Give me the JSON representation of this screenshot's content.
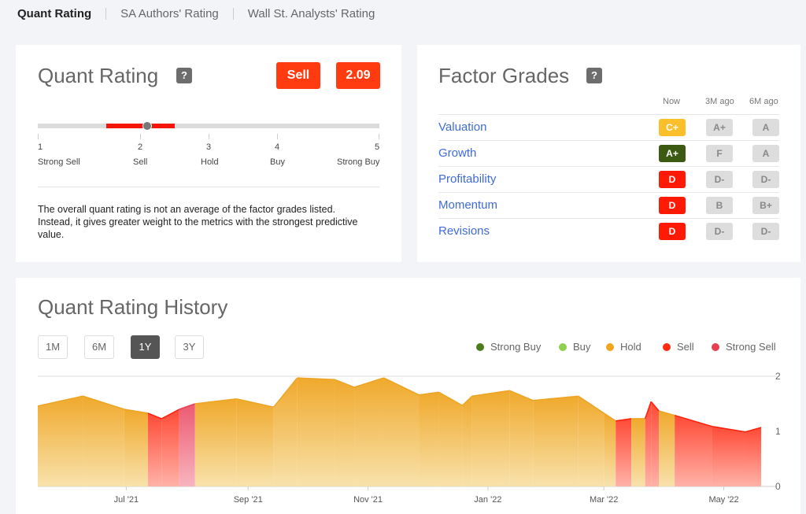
{
  "tabs": [
    "Quant Rating",
    "SA Authors' Rating",
    "Wall St. Analysts' Rating"
  ],
  "quant": {
    "title": "Quant Rating",
    "help": "?",
    "rating": "Sell",
    "score": "2.09",
    "scale": [
      {
        "n": "1",
        "label": "Strong Sell"
      },
      {
        "n": "2",
        "label": "Sell"
      },
      {
        "n": "3",
        "label": "Hold"
      },
      {
        "n": "4",
        "label": "Buy"
      },
      {
        "n": "5",
        "label": "Strong Buy"
      }
    ],
    "description": "The overall quant rating is not an average of the factor grades listed. Instead, it gives greater weight to the metrics with the strongest predictive value."
  },
  "factors": {
    "title": "Factor Grades",
    "help": "?",
    "columns": [
      "Now",
      "3M ago",
      "6M ago"
    ],
    "rows": [
      {
        "name": "Valuation",
        "now": "C+",
        "m3": "A+",
        "m6": "A",
        "now_color": "#fbbf2c"
      },
      {
        "name": "Growth",
        "now": "A+",
        "m3": "F",
        "m6": "A",
        "now_color": "#3d5a12"
      },
      {
        "name": "Profitability",
        "now": "D",
        "m3": "D-",
        "m6": "D-",
        "now_color": "#ff1a05"
      },
      {
        "name": "Momentum",
        "now": "D",
        "m3": "B",
        "m6": "B+",
        "now_color": "#ff1a05"
      },
      {
        "name": "Revisions",
        "now": "D",
        "m3": "D-",
        "m6": "D-",
        "now_color": "#ff1a05"
      }
    ]
  },
  "history": {
    "title": "Quant Rating History",
    "periods": [
      "1M",
      "6M",
      "1Y",
      "3Y"
    ],
    "active_period": "1Y",
    "legend": [
      {
        "label": "Strong Buy",
        "color": "#4a7c1c"
      },
      {
        "label": "Buy",
        "color": "#8fd14f"
      },
      {
        "label": "Hold",
        "color": "#f0a51e"
      },
      {
        "label": "Sell",
        "color": "#ff2a12"
      },
      {
        "label": "Strong Sell",
        "color": "#e8404f"
      }
    ]
  },
  "chart_data": {
    "type": "area",
    "x_start": "2021-05-17",
    "x_end": "2022-05-20",
    "ylim": [
      0,
      2
    ],
    "yticks": [
      "0",
      "1",
      "2"
    ],
    "xticks": [
      {
        "label": "Jul '21",
        "date": "2021-07-01"
      },
      {
        "label": "Sep '21",
        "date": "2021-09-01"
      },
      {
        "label": "Nov '21",
        "date": "2021-11-01"
      },
      {
        "label": "Jan '22",
        "date": "2022-01-01"
      },
      {
        "label": "Mar '22",
        "date": "2022-03-01"
      },
      {
        "label": "May '22",
        "date": "2022-05-01"
      }
    ],
    "points": [
      {
        "date": "2021-05-17",
        "value": 1.46,
        "rating": "Hold"
      },
      {
        "date": "2021-06-09",
        "value": 1.64,
        "rating": "Hold"
      },
      {
        "date": "2021-06-30",
        "value": 1.4,
        "rating": "Hold"
      },
      {
        "date": "2021-07-12",
        "value": 1.33,
        "rating": "Sell"
      },
      {
        "date": "2021-07-19",
        "value": 1.23,
        "rating": "Sell"
      },
      {
        "date": "2021-07-28",
        "value": 1.4,
        "rating": "Strong Sell"
      },
      {
        "date": "2021-08-05",
        "value": 1.5,
        "rating": "Hold"
      },
      {
        "date": "2021-08-26",
        "value": 1.59,
        "rating": "Hold"
      },
      {
        "date": "2021-09-14",
        "value": 1.44,
        "rating": "Hold"
      },
      {
        "date": "2021-09-26",
        "value": 1.97,
        "rating": "Hold"
      },
      {
        "date": "2021-10-15",
        "value": 1.94,
        "rating": "Hold"
      },
      {
        "date": "2021-10-25",
        "value": 1.8,
        "rating": "Hold"
      },
      {
        "date": "2021-11-09",
        "value": 1.97,
        "rating": "Hold"
      },
      {
        "date": "2021-11-27",
        "value": 1.66,
        "rating": "Hold"
      },
      {
        "date": "2021-12-07",
        "value": 1.71,
        "rating": "Hold"
      },
      {
        "date": "2021-12-19",
        "value": 1.47,
        "rating": "Hold"
      },
      {
        "date": "2021-12-24",
        "value": 1.64,
        "rating": "Hold"
      },
      {
        "date": "2022-01-12",
        "value": 1.74,
        "rating": "Hold"
      },
      {
        "date": "2022-01-24",
        "value": 1.56,
        "rating": "Hold"
      },
      {
        "date": "2022-02-16",
        "value": 1.64,
        "rating": "Hold"
      },
      {
        "date": "2022-03-01",
        "value": 1.33,
        "rating": "Hold"
      },
      {
        "date": "2022-03-07",
        "value": 1.19,
        "rating": "Sell"
      },
      {
        "date": "2022-03-15",
        "value": 1.23,
        "rating": "Hold"
      },
      {
        "date": "2022-03-22",
        "value": 1.23,
        "rating": "Sell"
      },
      {
        "date": "2022-03-25",
        "value": 1.54,
        "rating": "Sell"
      },
      {
        "date": "2022-03-29",
        "value": 1.37,
        "rating": "Hold"
      },
      {
        "date": "2022-04-06",
        "value": 1.29,
        "rating": "Sell"
      },
      {
        "date": "2022-04-25",
        "value": 1.09,
        "rating": "Sell"
      },
      {
        "date": "2022-05-12",
        "value": 0.99,
        "rating": "Sell"
      },
      {
        "date": "2022-05-20",
        "value": 1.07,
        "rating": "Sell"
      }
    ]
  }
}
